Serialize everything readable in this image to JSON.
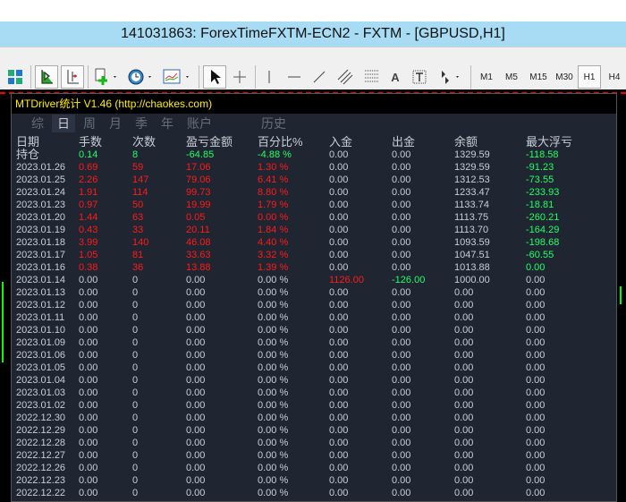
{
  "window": {
    "title": "141031863: ForexTimeFXTM-ECN2 - FXTM - [GBPUSD,H1]"
  },
  "toolbar": {
    "timeframes": [
      "M1",
      "M5",
      "M15",
      "M30",
      "H1",
      "H4"
    ],
    "active_timeframe": "H1",
    "text_tool": "A"
  },
  "panel": {
    "title": "MTDriver统计 V1.46  (http://chaokes.com)",
    "tabs": [
      "综",
      "日",
      "周",
      "月",
      "季",
      "年",
      "账户",
      "历史"
    ],
    "active_tab": "日",
    "columns": [
      "日期",
      "手数",
      "次数",
      "盈亏金额",
      "百分比%",
      "入金",
      "出金",
      "余额",
      "最大浮亏"
    ],
    "colors": {
      "positive": "#ff1a1a",
      "negative": "#22ff66",
      "neutral": "#c9ced6"
    },
    "rows": [
      [
        "持仓",
        "0.14",
        "8",
        "-64.85",
        "-4.88 %",
        "0.00",
        "0.00",
        "1329.59",
        "-118.58"
      ],
      [
        "2023.01.26",
        "0.69",
        "59",
        "17.06",
        "1.30 %",
        "0.00",
        "0.00",
        "1329.59",
        "-91.23"
      ],
      [
        "2023.01.25",
        "2.26",
        "147",
        "79.06",
        "6.41 %",
        "0.00",
        "0.00",
        "1312.53",
        "-73.55"
      ],
      [
        "2023.01.24",
        "1.91",
        "114",
        "99.73",
        "8.80 %",
        "0.00",
        "0.00",
        "1233.47",
        "-233.93"
      ],
      [
        "2023.01.23",
        "0.97",
        "50",
        "19.99",
        "1.79 %",
        "0.00",
        "0.00",
        "1133.74",
        "-18.81"
      ],
      [
        "2023.01.20",
        "1.44",
        "63",
        "0.05",
        "0.00 %",
        "0.00",
        "0.00",
        "1113.75",
        "-260.21"
      ],
      [
        "2023.01.19",
        "0.43",
        "33",
        "20.11",
        "1.84 %",
        "0.00",
        "0.00",
        "1113.70",
        "-164.29"
      ],
      [
        "2023.01.18",
        "3.99",
        "140",
        "46.08",
        "4.40 %",
        "0.00",
        "0.00",
        "1093.59",
        "-198.68"
      ],
      [
        "2023.01.17",
        "1.05",
        "81",
        "33.63",
        "3.32 %",
        "0.00",
        "0.00",
        "1047.51",
        "-60.55"
      ],
      [
        "2023.01.16",
        "0.38",
        "36",
        "13.88",
        "1.39 %",
        "0.00",
        "0.00",
        "1013.88",
        "0.00"
      ],
      [
        "2023.01.14",
        "0.00",
        "0",
        "0.00",
        "0.00 %",
        "1126.00",
        "-126.00",
        "1000.00",
        "0.00"
      ],
      [
        "2023.01.13",
        "0.00",
        "0",
        "0.00",
        "0.00 %",
        "0.00",
        "0.00",
        "0.00",
        "0.00"
      ],
      [
        "2023.01.12",
        "0.00",
        "0",
        "0.00",
        "0.00 %",
        "0.00",
        "0.00",
        "0.00",
        "0.00"
      ],
      [
        "2023.01.11",
        "0.00",
        "0",
        "0.00",
        "0.00 %",
        "0.00",
        "0.00",
        "0.00",
        "0.00"
      ],
      [
        "2023.01.10",
        "0.00",
        "0",
        "0.00",
        "0.00 %",
        "0.00",
        "0.00",
        "0.00",
        "0.00"
      ],
      [
        "2023.01.09",
        "0.00",
        "0",
        "0.00",
        "0.00 %",
        "0.00",
        "0.00",
        "0.00",
        "0.00"
      ],
      [
        "2023.01.06",
        "0.00",
        "0",
        "0.00",
        "0.00 %",
        "0.00",
        "0.00",
        "0.00",
        "0.00"
      ],
      [
        "2023.01.05",
        "0.00",
        "0",
        "0.00",
        "0.00 %",
        "0.00",
        "0.00",
        "0.00",
        "0.00"
      ],
      [
        "2023.01.04",
        "0.00",
        "0",
        "0.00",
        "0.00 %",
        "0.00",
        "0.00",
        "0.00",
        "0.00"
      ],
      [
        "2023.01.03",
        "0.00",
        "0",
        "0.00",
        "0.00 %",
        "0.00",
        "0.00",
        "0.00",
        "0.00"
      ],
      [
        "2023.01.02",
        "0.00",
        "0",
        "0.00",
        "0.00 %",
        "0.00",
        "0.00",
        "0.00",
        "0.00"
      ],
      [
        "2022.12.30",
        "0.00",
        "0",
        "0.00",
        "0.00 %",
        "0.00",
        "0.00",
        "0.00",
        "0.00"
      ],
      [
        "2022.12.29",
        "0.00",
        "0",
        "0.00",
        "0.00 %",
        "0.00",
        "0.00",
        "0.00",
        "0.00"
      ],
      [
        "2022.12.28",
        "0.00",
        "0",
        "0.00",
        "0.00 %",
        "0.00",
        "0.00",
        "0.00",
        "0.00"
      ],
      [
        "2022.12.27",
        "0.00",
        "0",
        "0.00",
        "0.00 %",
        "0.00",
        "0.00",
        "0.00",
        "0.00"
      ],
      [
        "2022.12.26",
        "0.00",
        "0",
        "0.00",
        "0.00 %",
        "0.00",
        "0.00",
        "0.00",
        "0.00"
      ],
      [
        "2022.12.23",
        "0.00",
        "0",
        "0.00",
        "0.00 %",
        "0.00",
        "0.00",
        "0.00",
        "0.00"
      ],
      [
        "2022.12.22",
        "0.00",
        "0",
        "0.00",
        "0.00 %",
        "0.00",
        "0.00",
        "0.00",
        "0.00"
      ]
    ],
    "row_colors": [
      [
        "w",
        "g",
        "g",
        "g",
        "g",
        "w",
        "w",
        "w",
        "g"
      ],
      [
        "w",
        "r",
        "r",
        "r",
        "r",
        "w",
        "w",
        "w",
        "g"
      ],
      [
        "w",
        "w",
        "w",
        "w",
        "w",
        "r",
        "g",
        "w",
        "w"
      ]
    ]
  }
}
